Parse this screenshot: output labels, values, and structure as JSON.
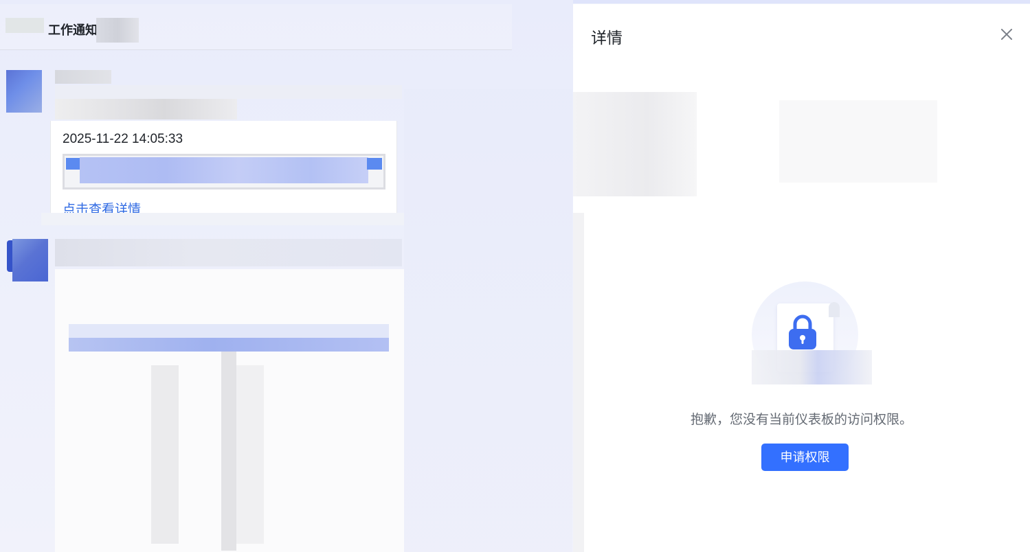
{
  "chat": {
    "title": "工作通知",
    "message": {
      "time": "2025-11-22 14:05:33",
      "link": "点击查看详情"
    }
  },
  "detail": {
    "title": "详情",
    "message": "抱歉，您没有当前仪表板的访问权限。",
    "apply_button": "申请权限"
  },
  "colors": {
    "accent": "#3370ff",
    "link": "#2f6ae3",
    "lock": "#3d6df0"
  }
}
